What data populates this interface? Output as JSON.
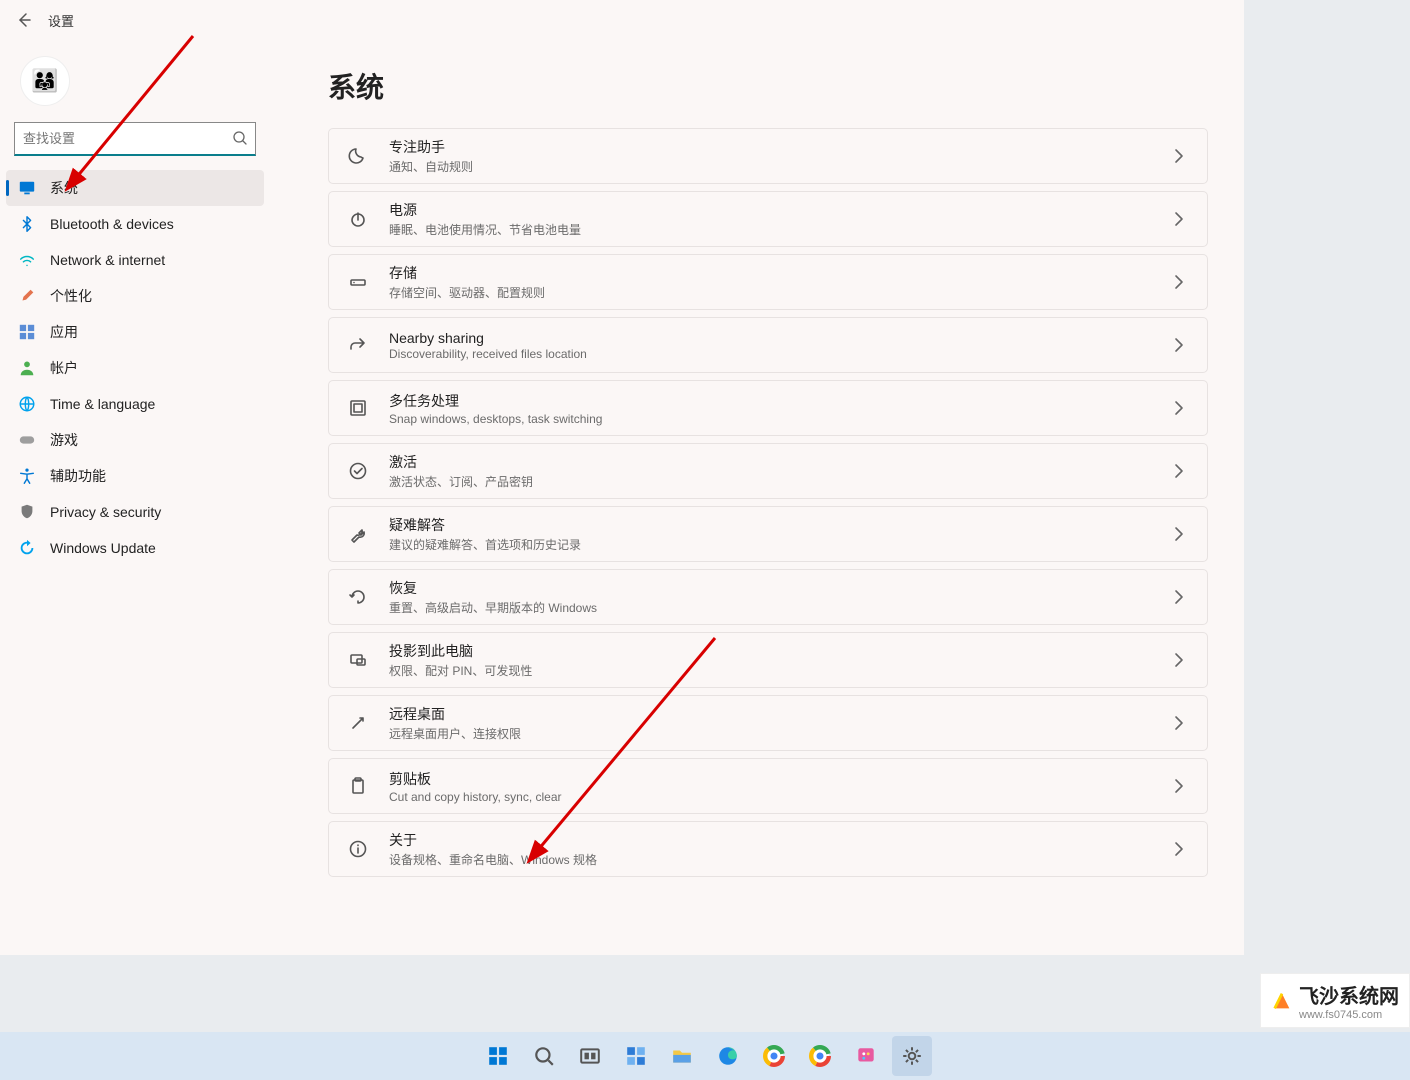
{
  "window": {
    "title": "设置"
  },
  "search": {
    "placeholder": "查找设置"
  },
  "sidebar": {
    "items": [
      {
        "label": "系统",
        "icon": "monitor",
        "color": "#0078d4"
      },
      {
        "label": "Bluetooth & devices",
        "icon": "bluetooth",
        "color": "#0078d4"
      },
      {
        "label": "Network & internet",
        "icon": "wifi",
        "color": "#00b7c3"
      },
      {
        "label": "个性化",
        "icon": "brush",
        "color": "#e3734e"
      },
      {
        "label": "应用",
        "icon": "apps",
        "color": "#5b8dd6"
      },
      {
        "label": "帐户",
        "icon": "person",
        "color": "#4caf50"
      },
      {
        "label": "Time & language",
        "icon": "globe",
        "color": "#00a2ed"
      },
      {
        "label": "游戏",
        "icon": "gamepad",
        "color": "#9e9e9e"
      },
      {
        "label": "辅助功能",
        "icon": "accessibility",
        "color": "#0078d4"
      },
      {
        "label": "Privacy & security",
        "icon": "shield",
        "color": "#7a7a7a"
      },
      {
        "label": "Windows Update",
        "icon": "update",
        "color": "#00a2ed"
      }
    ],
    "active_index": 0
  },
  "page": {
    "title": "系统",
    "cards": [
      {
        "icon": "moon",
        "title": "专注助手",
        "subtitle": "通知、自动规则"
      },
      {
        "icon": "power",
        "title": "电源",
        "subtitle": "睡眠、电池使用情况、节省电池电量"
      },
      {
        "icon": "storage",
        "title": "存储",
        "subtitle": "存储空间、驱动器、配置规则"
      },
      {
        "icon": "share",
        "title": "Nearby sharing",
        "subtitle": "Discoverability, received files location"
      },
      {
        "icon": "multitask",
        "title": "多任务处理",
        "subtitle": "Snap windows, desktops, task switching"
      },
      {
        "icon": "check",
        "title": "激活",
        "subtitle": "激活状态、订阅、产品密钥"
      },
      {
        "icon": "wrench",
        "title": "疑难解答",
        "subtitle": "建议的疑难解答、首选项和历史记录"
      },
      {
        "icon": "recover",
        "title": "恢复",
        "subtitle": "重置、高级启动、早期版本的 Windows"
      },
      {
        "icon": "project",
        "title": "投影到此电脑",
        "subtitle": "权限、配对 PIN、可发现性"
      },
      {
        "icon": "remote",
        "title": "远程桌面",
        "subtitle": "远程桌面用户、连接权限"
      },
      {
        "icon": "clipboard",
        "title": "剪贴板",
        "subtitle": "Cut and copy history, sync, clear"
      },
      {
        "icon": "info",
        "title": "关于",
        "subtitle": "设备规格、重命名电脑、Windows 规格"
      }
    ]
  },
  "taskbar": {
    "items": [
      {
        "name": "start",
        "color": "#0078d4"
      },
      {
        "name": "search",
        "color": "#555"
      },
      {
        "name": "taskview",
        "color": "#555"
      },
      {
        "name": "widgets",
        "color": "#2e7cd6"
      },
      {
        "name": "explorer",
        "color": "#f5c845"
      },
      {
        "name": "edge",
        "color": "#1e88e5"
      },
      {
        "name": "chrome1",
        "color": "#ea4335"
      },
      {
        "name": "chrome2",
        "color": "#ea4335"
      },
      {
        "name": "paint",
        "color": "#e85aa0"
      },
      {
        "name": "settings",
        "color": "#555"
      }
    ],
    "active_index": 9
  },
  "watermark": {
    "name": "飞沙系统网",
    "url": "www.fs0745.com"
  }
}
